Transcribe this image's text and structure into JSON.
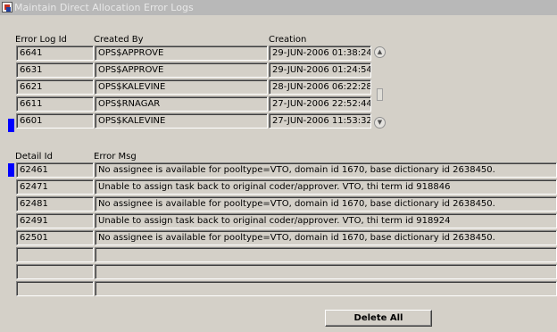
{
  "window": {
    "title": "Maintain Direct Allocation Error Logs"
  },
  "logs": {
    "headers": {
      "id": "Error Log Id",
      "created_by": "Created By",
      "creation": "Creation"
    },
    "rows": [
      {
        "id": "6641",
        "created_by": "OPS$APPROVE",
        "creation": "29-JUN-2006 01:38:24"
      },
      {
        "id": "6631",
        "created_by": "OPS$APPROVE",
        "creation": "29-JUN-2006 01:24:54"
      },
      {
        "id": "6621",
        "created_by": "OPS$KALEVINE",
        "creation": "28-JUN-2006 06:22:28"
      },
      {
        "id": "6611",
        "created_by": "OPS$RNAGAR",
        "creation": "27-JUN-2006 22:52:44"
      },
      {
        "id": "6601",
        "created_by": "OPS$KALEVINE",
        "creation": "27-JUN-2006 11:53:32"
      }
    ]
  },
  "details": {
    "headers": {
      "id": "Detail Id",
      "msg": "Error Msg"
    },
    "rows": [
      {
        "id": "62461",
        "msg": "No assignee is available for pooltype=VTO, domain id 1670, base dictionary id 2638450."
      },
      {
        "id": "62471",
        "msg": "Unable to assign task back to original coder/approver. VTO, thi term id 918846"
      },
      {
        "id": "62481",
        "msg": "No assignee is available for pooltype=VTO, domain id 1670, base dictionary id 2638450."
      },
      {
        "id": "62491",
        "msg": "Unable to assign task back to original coder/approver. VTO, thi term id 918924"
      },
      {
        "id": "62501",
        "msg": "No assignee is available for pooltype=VTO, domain id 1670, base dictionary id 2638450."
      },
      {
        "id": "",
        "msg": ""
      },
      {
        "id": "",
        "msg": ""
      },
      {
        "id": "",
        "msg": ""
      }
    ]
  },
  "buttons": {
    "delete_all": "Delete All"
  },
  "icons": {
    "app": "form-app-icon",
    "scroll_up": "scroll-up-icon",
    "scroll_down": "scroll-down-icon",
    "record_indicator": "current-record-indicator"
  },
  "colors": {
    "indicator": "#0000ff",
    "background": "#d4d0c8",
    "titlebar": "#b8b8b8"
  }
}
